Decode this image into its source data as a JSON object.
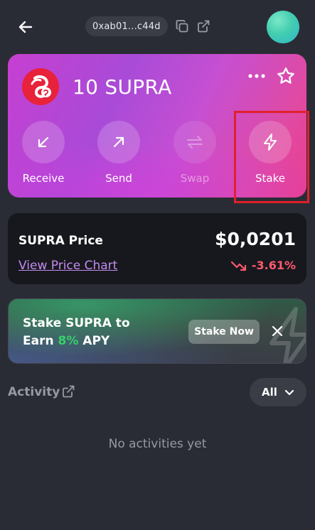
{
  "header": {
    "address": "0xab01...c44d",
    "icons": {
      "back": "arrow-left-icon",
      "copy": "copy-icon",
      "external": "external-link-icon",
      "avatar": "avatar"
    }
  },
  "token_card": {
    "amount": "10 SUPRA",
    "logo": "supra-logo",
    "actions": [
      {
        "label": "Receive",
        "icon": "arrow-down-left-icon",
        "enabled": true
      },
      {
        "label": "Send",
        "icon": "arrow-up-right-icon",
        "enabled": true
      },
      {
        "label": "Swap",
        "icon": "swap-arrows-icon",
        "enabled": false
      },
      {
        "label": "Stake",
        "icon": "lightning-icon",
        "enabled": true,
        "highlighted": true
      }
    ],
    "icons": {
      "more": "more-dots-icon",
      "favorite": "star-icon"
    },
    "gradient": [
      "#c63fd1",
      "#e83f8f"
    ]
  },
  "price_card": {
    "title": "SUPRA Price",
    "link": "View Price Chart",
    "value": "$0,0201",
    "change": "-3.61%",
    "change_color": "#ff5a6e"
  },
  "promo": {
    "line1": "Stake SUPRA to",
    "line2_prefix": "Earn ",
    "line2_highlight": "8%",
    "line2_suffix": " APY",
    "button": "Stake Now",
    "highlight_color": "#37d06b"
  },
  "activity": {
    "label": "Activity",
    "filter": "All",
    "empty": "No activities yet"
  },
  "colors": {
    "background": "#2a2c35",
    "highlight_box": "#e0202b",
    "link": "#c38cf0"
  }
}
